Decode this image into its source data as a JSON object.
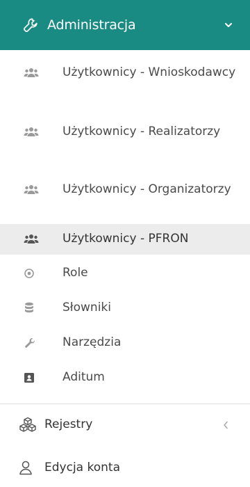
{
  "header": {
    "title": "Administracja",
    "icon": "wrench-icon",
    "color": "#1a8b83"
  },
  "submenu": [
    {
      "label": "Użytkownicy - Wnioskodawcy",
      "icon": "users-icon"
    },
    {
      "label": "Użytkownicy - Realizatorzy",
      "icon": "users-icon"
    },
    {
      "label": "Użytkownicy - Organizatorzy",
      "icon": "users-icon"
    },
    {
      "label": "Użytkownicy - PFRON",
      "icon": "users-icon",
      "active": true
    },
    {
      "label": "Role",
      "icon": "dot-circle-icon"
    },
    {
      "label": "Słowniki",
      "icon": "database-icon"
    },
    {
      "label": "Narzędzia",
      "icon": "wrench-icon"
    },
    {
      "label": "Aditum",
      "icon": "id-card-icon"
    }
  ],
  "registers": {
    "label": "Rejestry",
    "icon": "cubes-icon"
  },
  "account": {
    "label": "Edycja konta",
    "icon": "user-icon"
  }
}
